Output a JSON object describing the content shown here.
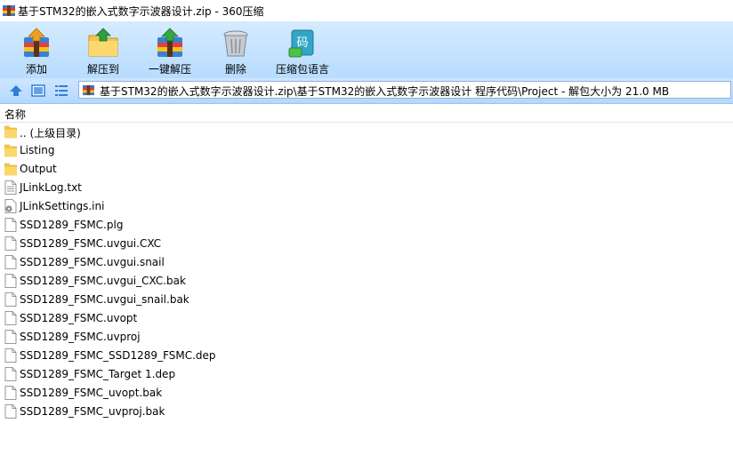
{
  "window": {
    "title": "基于STM32的嵌入式数字示波器设计.zip - 360压缩"
  },
  "toolbar": {
    "add_label": "添加",
    "extract_to_label": "解压到",
    "one_click_label": "一键解压",
    "delete_label": "删除",
    "lang_label": "压缩包语言",
    "lang_icon_text": "码"
  },
  "address": {
    "path": "基于STM32的嵌入式数字示波器设计.zip\\基于STM32的嵌入式数字示波器设计 程序代码\\Project - 解包大小为 21.0 MB"
  },
  "header": {
    "name_col": "名称"
  },
  "files": [
    {
      "name": ".. (上级目录)",
      "type": "folder"
    },
    {
      "name": "Listing",
      "type": "folder"
    },
    {
      "name": "Output",
      "type": "folder"
    },
    {
      "name": "JLinkLog.txt",
      "type": "text"
    },
    {
      "name": "JLinkSettings.ini",
      "type": "ini"
    },
    {
      "name": "SSD1289_FSMC.plg",
      "type": "file"
    },
    {
      "name": "SSD1289_FSMC.uvgui.CXC",
      "type": "file"
    },
    {
      "name": "SSD1289_FSMC.uvgui.snail",
      "type": "file"
    },
    {
      "name": "SSD1289_FSMC.uvgui_CXC.bak",
      "type": "file"
    },
    {
      "name": "SSD1289_FSMC.uvgui_snail.bak",
      "type": "file"
    },
    {
      "name": "SSD1289_FSMC.uvopt",
      "type": "file"
    },
    {
      "name": "SSD1289_FSMC.uvproj",
      "type": "file"
    },
    {
      "name": "SSD1289_FSMC_SSD1289_FSMC.dep",
      "type": "file"
    },
    {
      "name": "SSD1289_FSMC_Target 1.dep",
      "type": "file"
    },
    {
      "name": "SSD1289_FSMC_uvopt.bak",
      "type": "file"
    },
    {
      "name": "SSD1289_FSMC_uvproj.bak",
      "type": "file"
    }
  ]
}
